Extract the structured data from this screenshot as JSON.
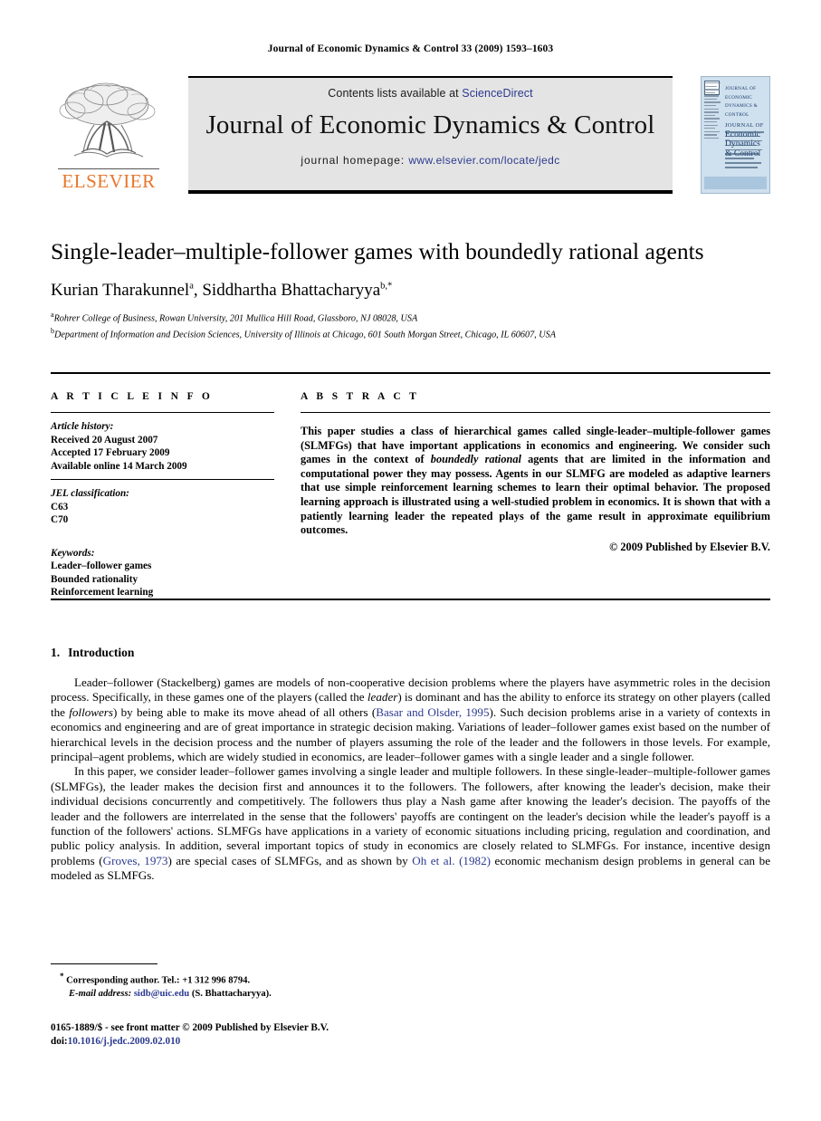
{
  "running_head": "Journal of Economic Dynamics & Control 33 (2009) 1593–1603",
  "masthead": {
    "publisher_name": "ELSEVIER",
    "contents_prefix": "Contents lists available at",
    "contents_link": "ScienceDirect",
    "journal_title": "Journal of Economic Dynamics & Control",
    "homepage_prefix": "journal homepage:",
    "homepage_url": "www.elsevier.com/locate/jedc",
    "cover": {
      "line_small": "JOURNAL OF ECONOMIC DYNAMICS & CONTROL",
      "line_journal": "JOURNAL OF",
      "line_a": "Economic",
      "line_b": "Dynamics",
      "line_c": "& Control"
    },
    "colors": {
      "elsevier_orange": "#E8762C",
      "link_blue": "#2b3a8f",
      "masthead_grey": "#e4e4e4",
      "cover_blue": "#cfe0ee"
    }
  },
  "article": {
    "title": "Single-leader–multiple-follower games with boundedly rational agents",
    "authors_prefix": "Kurian Tharakunnel ",
    "author_1": "Kurian Tharakunnel",
    "author_1_sup": "a",
    "author_sep": ", ",
    "author_2": "Siddhartha Bhattacharyya",
    "author_2_sup": "b,*",
    "affiliations": [
      {
        "sup": "a",
        "text": "Rohrer College of Business, Rowan University, 201 Mullica Hill Road, Glassboro, NJ 08028, USA"
      },
      {
        "sup": "b",
        "text": "Department of Information and Decision Sciences, University of Illinois at Chicago, 601 South Morgan Street, Chicago, IL 60607, USA"
      }
    ]
  },
  "article_info": {
    "heading": "A R T I C L E   I N F O",
    "history_head": "Article history:",
    "history": [
      "Received 20 August 2007",
      "Accepted 17 February 2009",
      "Available online 14 March 2009"
    ],
    "jel_head": "JEL classification:",
    "jel_codes": [
      "C63",
      "C70"
    ],
    "keywords_head": "Keywords:",
    "keywords": [
      "Leader–follower games",
      "Bounded rationality",
      "Reinforcement learning"
    ]
  },
  "abstract": {
    "heading": "A B S T R A C T",
    "part_1": "This paper studies a class of hierarchical games called single-leader–multiple-follower games (SLMFGs) that have important applications in economics and engineering. We consider such games in the context of ",
    "emphasis": "boundedly rational",
    "part_2": " agents that are limited in the information and computational power they may possess. Agents in our SLMFG are modeled as adaptive learners that use simple reinforcement learning schemes to learn their optimal behavior. The proposed learning approach is illustrated using a well-studied problem in economics. It is shown that with a patiently learning leader the repeated plays of the game result in approximate equilibrium outcomes.",
    "copyright": "© 2009 Published by Elsevier B.V."
  },
  "body": {
    "section_number": "1.",
    "section_title": "Introduction",
    "paragraph_1": {
      "p1a": "Leader–follower (Stackelberg) games are models of non-cooperative decision problems where the players have asymmetric roles in the decision process. Specifically, in these games one of the players (called the ",
      "em1": "leader",
      "p1b": ") is dominant and has the ability to enforce its strategy on other players (called the ",
      "em2": "followers",
      "p1c": ") by being able to make its move ahead of all others (",
      "cite1": "Basar and Olsder, 1995",
      "p1d": "). Such decision problems arise in a variety of contexts in economics and engineering and are of great importance in strategic decision making. Variations of leader–follower games exist based on the number of hierarchical levels in the decision process and the number of players assuming the role of the leader and the followers in those levels. For example, principal–agent problems, which are widely studied in economics, are leader–follower games with a single leader and a single follower."
    },
    "paragraph_2": {
      "p2a": "In this paper, we consider leader–follower games involving a single leader and multiple followers. In these single-leader–multiple-follower games (SLMFGs), the leader makes the decision first and announces it to the followers. The followers, after knowing the leader's decision, make their individual decisions concurrently and competitively. The followers thus play a Nash game after knowing the leader's decision. The payoffs of the leader and the followers are interrelated in the sense that the followers' payoffs are contingent on the leader's decision while the leader's payoff is a function of the followers' actions. SLMFGs have applications in a variety of economic situations including pricing, regulation and coordination, and public policy analysis. In addition, several important topics of study in economics are closely related to SLMFGs. For instance, incentive design problems (",
      "cite2": "Groves, 1973",
      "p2b": ") are special cases of SLMFGs, and as shown by ",
      "cite3": "Oh et al. (1982)",
      "p2c": " economic mechanism design problems in general can be modeled as SLMFGs."
    }
  },
  "footnote": {
    "marker": "*",
    "corresponding": "Corresponding author. Tel.: +1 312 996 8794.",
    "email_label": "E-mail address:",
    "email": "sidb@uic.edu",
    "email_owner": "(S. Bhattacharyya)."
  },
  "imprint": {
    "front_matter": "0165-1889/$ - see front matter © 2009 Published by Elsevier B.V.",
    "doi_label": "doi:",
    "doi": "10.1016/j.jedc.2009.02.010"
  }
}
